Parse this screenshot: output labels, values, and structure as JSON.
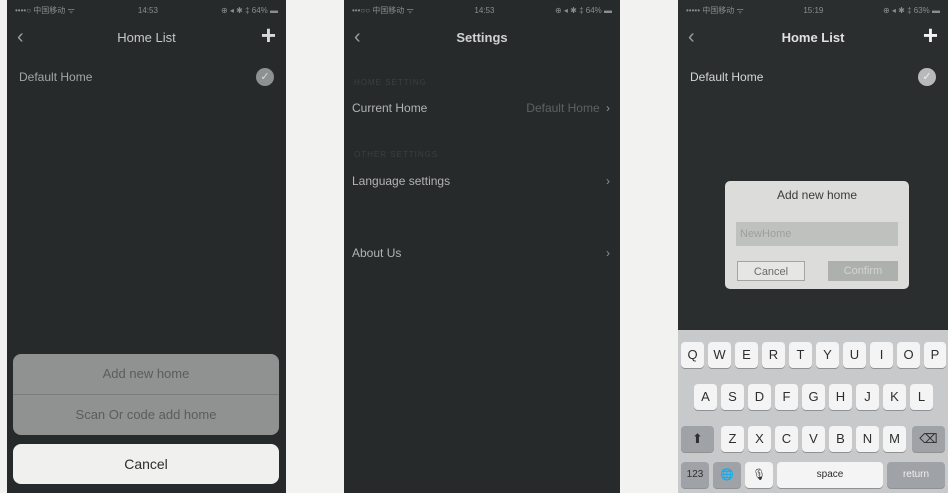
{
  "screens": [
    {
      "status": {
        "carrier": "••••○ 中国移动 ᯤ",
        "time": "14:53",
        "battery": "⊕ ◂ ✱ ‡ 64% ▬"
      },
      "nav": {
        "back": "‹",
        "title": "Home List",
        "add": "+"
      },
      "home_row": {
        "label": "Default Home",
        "check": "✓"
      },
      "action_sheet": {
        "items": [
          "Add new home",
          "Scan Or code add home"
        ],
        "cancel": "Cancel"
      }
    },
    {
      "status": {
        "carrier": "•••○○ 中国移动 ᯤ",
        "time": "14:53",
        "battery": "⊕ ◂ ✱ ‡ 64% ▬"
      },
      "nav": {
        "back": "‹",
        "title": "Settings"
      },
      "section_home": "HOME SETTING",
      "current_home": {
        "label": "Current Home",
        "value": "Default Home",
        "chevron": "›"
      },
      "section_other": "OTHER SETTINGS",
      "language": {
        "label": "Language settings",
        "chevron": "›"
      },
      "about": {
        "label": "About Us",
        "chevron": "›"
      }
    },
    {
      "status": {
        "carrier": "••••• 中国移动 ᯤ",
        "time": "15:19",
        "battery": "⊕ ◂ ✱ ‡ 63% ▬"
      },
      "nav": {
        "back": "‹",
        "title": "Home List",
        "add": "+"
      },
      "home_row": {
        "label": "Default Home",
        "check": "✓"
      },
      "dialog": {
        "title": "Add new home",
        "input_placeholder": "NewHome",
        "cancel": "Cancel",
        "confirm": "Confirm"
      },
      "keyboard": {
        "row1": [
          "Q",
          "W",
          "E",
          "R",
          "T",
          "Y",
          "U",
          "I",
          "O",
          "P"
        ],
        "row2": [
          "A",
          "S",
          "D",
          "F",
          "G",
          "H",
          "J",
          "K",
          "L"
        ],
        "row3": [
          "Z",
          "X",
          "C",
          "V",
          "B",
          "N",
          "M"
        ],
        "shift": "⬆",
        "delete": "⌫",
        "numbers": "123",
        "globe": "🌐",
        "mic": "🎙",
        "space": "space",
        "return": "return"
      }
    }
  ]
}
